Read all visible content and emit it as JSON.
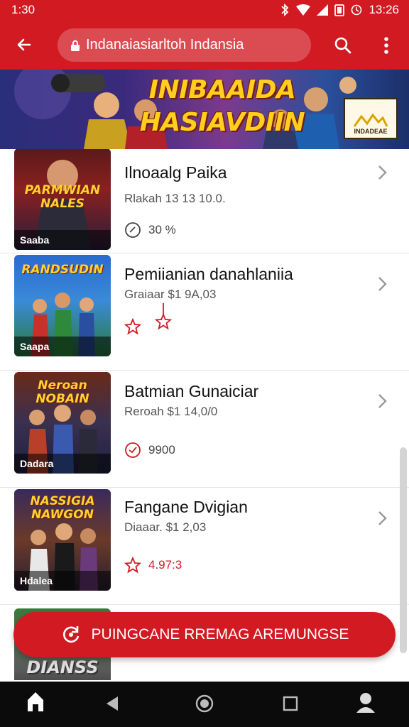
{
  "status_bar": {
    "time": "1:30",
    "clock": "13:26"
  },
  "app_bar": {
    "url": "Indanaiasiarltoh Indansia"
  },
  "banner": {
    "title_line1": "INIBAAIDA",
    "title_line2": "HASIAVDIIN",
    "logo_text": "INDADEAE"
  },
  "games": [
    {
      "title": "Ilnoaalg Paika",
      "subtitle": "Rlakah 13 13 10.0.",
      "meta": "30 %",
      "meta_icon": "clock-icon",
      "thumb_title": "PARMWIAN NALES",
      "thumb_tag": "Saaba"
    },
    {
      "title": "Pemiianian danahlaniia",
      "subtitle": "Graiaar $1 9A,03",
      "meta": "",
      "meta_icon": "star-icon",
      "thumb_title": "RANDSUDIN",
      "thumb_tag": "Saapa"
    },
    {
      "title": "Batmian Gunaiciar",
      "subtitle": "Reroah $1 14,0/0",
      "meta": "9900",
      "meta_icon": "clock-icon",
      "thumb_title": "Neroan NOBAIN",
      "thumb_tag": "Dadara"
    },
    {
      "title": "Fangane Dvigian",
      "subtitle": "Diaaar. $1 2,03",
      "meta": "4.97:3",
      "meta_icon": "star-icon",
      "thumb_title": "NASSIGIA NAWGON",
      "thumb_tag": "Hdalea"
    }
  ],
  "partial_thumb_title": "DIANSS",
  "cta": {
    "label": "PUINGCANE RREMAG AREMUNGSE"
  },
  "colors": {
    "primary": "#d11a22",
    "star": "#d11a22"
  }
}
